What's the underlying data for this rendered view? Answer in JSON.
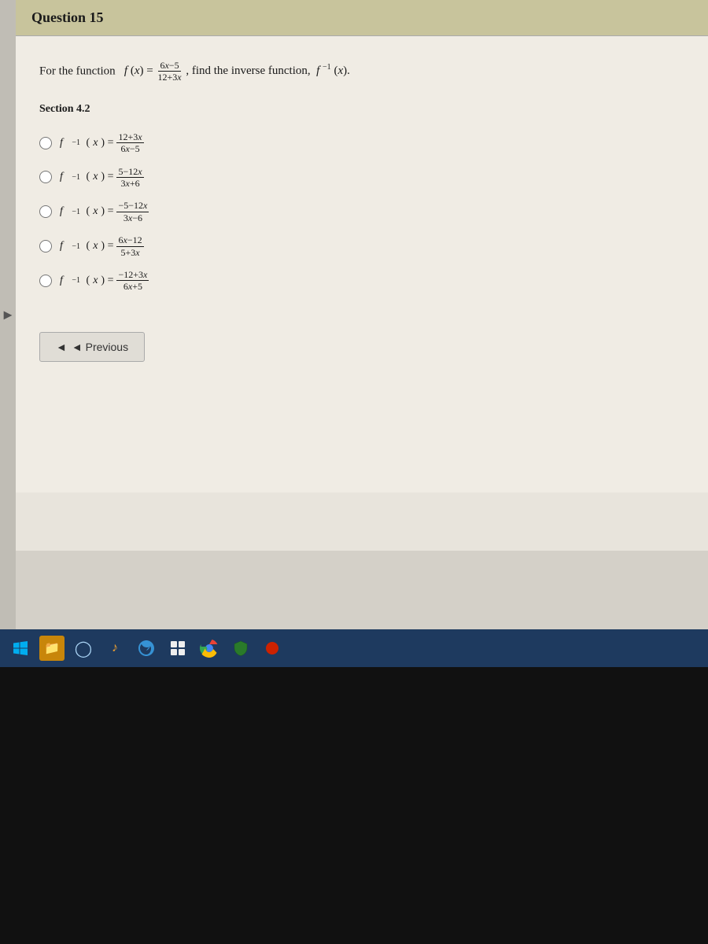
{
  "question": {
    "number": "Question 15",
    "header_label": "Question 15",
    "prompt": "For the function",
    "function_desc": "f(x) = (6x−5)/(12+3x), find the inverse function, f⁻¹(x).",
    "section": "Section 4.2"
  },
  "options": [
    {
      "id": "opt1",
      "label": "f⁻¹(x) = (12+3x)/(6x−5)",
      "numer": "12+3x",
      "denom": "6x−5"
    },
    {
      "id": "opt2",
      "label": "f⁻¹(x) = (5−12x)/(3x+6)",
      "numer": "5−12x",
      "denom": "3x+6"
    },
    {
      "id": "opt3",
      "label": "f⁻¹(x) = (−5−12x)/(3x−6)",
      "numer": "−5−12x",
      "denom": "3x−6"
    },
    {
      "id": "opt4",
      "label": "f⁻¹(x) = (6x−12)/(5+3x)",
      "numer": "6x−12",
      "denom": "5+3x"
    },
    {
      "id": "opt5",
      "label": "f⁻¹(x) = (−12+3x)/(6x+5)",
      "numer": "−12+3x",
      "denom": "6x+5"
    }
  ],
  "navigation": {
    "previous_label": "◄ Previous"
  },
  "taskbar": {
    "icons": [
      "windows",
      "files",
      "cortana",
      "music",
      "edge",
      "grid",
      "chrome",
      "shield",
      "dot"
    ]
  }
}
